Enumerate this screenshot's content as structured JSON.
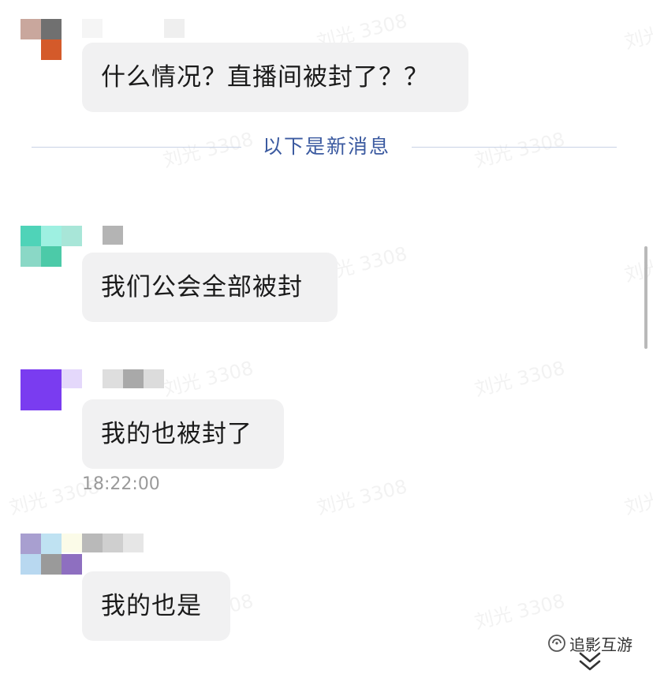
{
  "watermark": "刘光 3308",
  "messages": [
    {
      "text": "什么情况？直播间被封了？？"
    },
    {
      "text": "我们公会全部被封"
    },
    {
      "text": "我的也被封了",
      "time": "18:22:00"
    },
    {
      "text": "我的也是"
    }
  ],
  "divider": {
    "label": "以下是新消息"
  },
  "brand": {
    "icon": "wechat-official-account-icon",
    "label": "追影互游"
  },
  "scroll_button": {
    "icon": "double-chevron-down-icon"
  },
  "colors": {
    "bubble": "#f1f1f2",
    "divider_text": "#3b5aa0",
    "divider_line": "#c9d3e6",
    "timestamp": "#9a9a9a"
  }
}
